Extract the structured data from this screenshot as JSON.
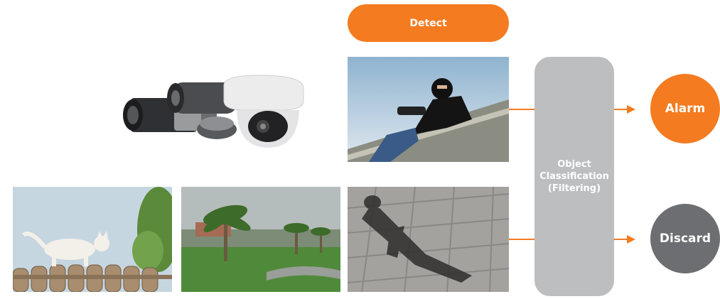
{
  "detect": {
    "label": "Detect"
  },
  "classification": {
    "lines": [
      "Object",
      "Classification",
      "(Filtering)"
    ]
  },
  "outputs": {
    "alarm": "Alarm",
    "discard": "Discard"
  },
  "colors": {
    "accent": "#f47b20",
    "box": "#bcbec0",
    "discard": "#6d6e71"
  },
  "images": {
    "cameras": "security-cameras-image",
    "thief": "intruder-on-roof-image",
    "shadow": "person-shadow-image",
    "cat": "cat-on-fence-image",
    "palm": "palm-trees-in-wind-image"
  }
}
